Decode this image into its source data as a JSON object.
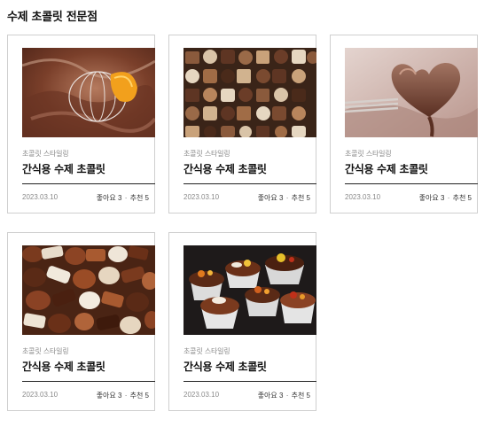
{
  "page": {
    "title": "수제 초콜릿 전문점"
  },
  "cards": [
    {
      "category": "초콜릿 스타일링",
      "title": "간식용 수제 초콜릿",
      "date": "2023.03.10",
      "likes_label": "좋아요 3",
      "separator": "·",
      "recommend_label": "추천 5",
      "image": "melting-chocolate-whisk-photo"
    },
    {
      "category": "초콜릿 스타일링",
      "title": "간식용 수제 초콜릿",
      "date": "2023.03.10",
      "likes_label": "좋아요 3",
      "separator": "·",
      "recommend_label": "추천 5",
      "image": "assorted-chocolate-grid-photo"
    },
    {
      "category": "초콜릿 스타일링",
      "title": "간식용 수제 초콜릿",
      "date": "2023.03.10",
      "likes_label": "좋아요 3",
      "separator": "·",
      "recommend_label": "추천 5",
      "image": "heart-chocolate-fork-photo"
    },
    {
      "category": "초콜릿 스타일링",
      "title": "간식용 수제 초콜릿",
      "date": "2023.03.10",
      "likes_label": "좋아요 3",
      "separator": "·",
      "recommend_label": "추천 5",
      "image": "pile-of-chocolates-photo"
    },
    {
      "category": "초콜릿 스타일링",
      "title": "간식용 수제 초콜릿",
      "date": "2023.03.10",
      "likes_label": "좋아요 3",
      "separator": "·",
      "recommend_label": "추천 5",
      "image": "chocolate-cupcakes-photo"
    }
  ]
}
